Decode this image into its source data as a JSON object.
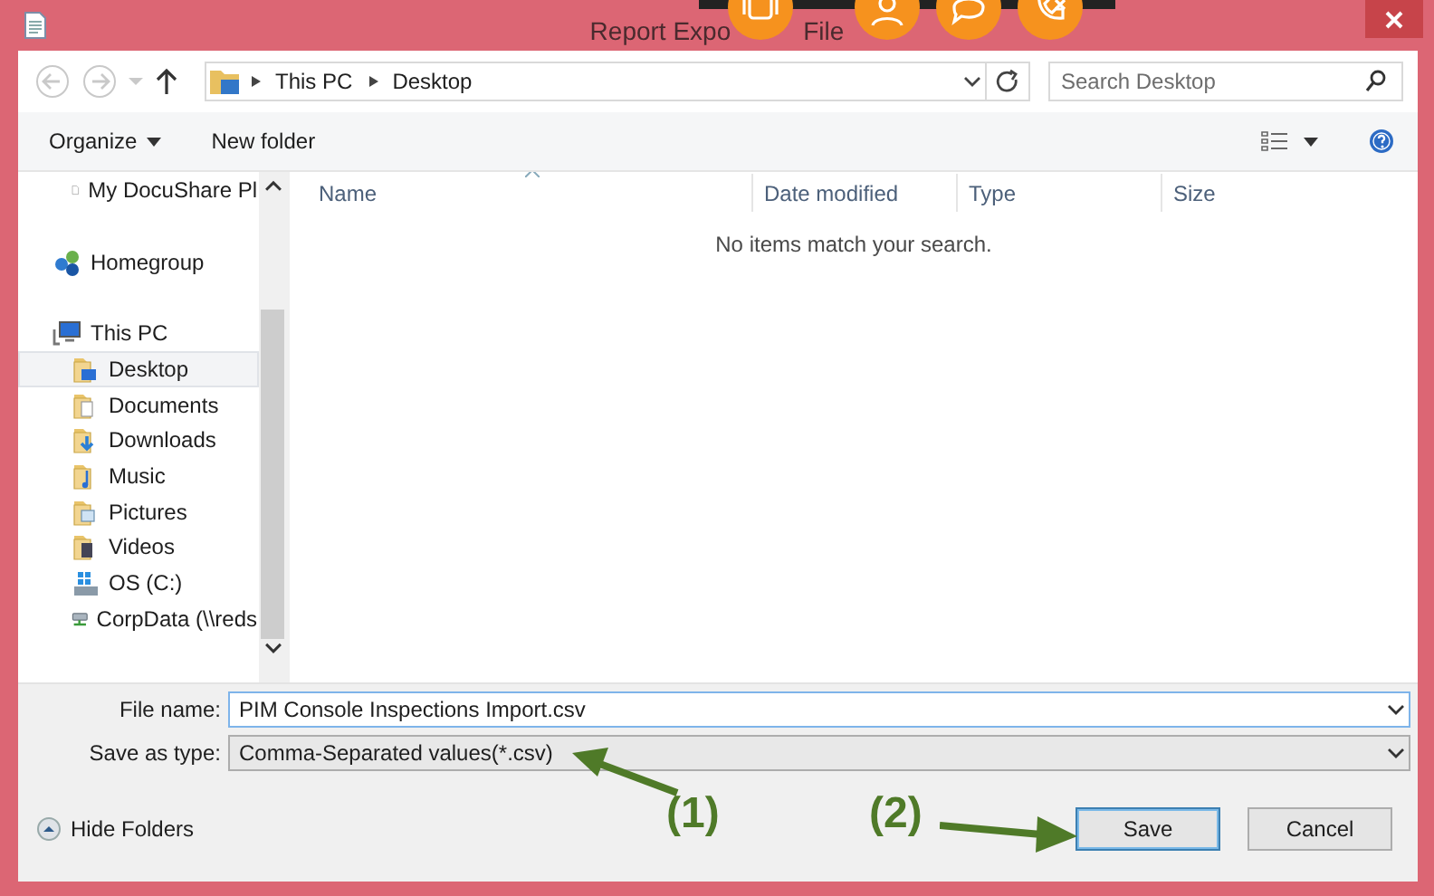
{
  "window": {
    "title_segments": [
      "Report Expo",
      "File"
    ]
  },
  "address_bar": {
    "path": [
      "This PC",
      "Desktop"
    ]
  },
  "search": {
    "placeholder": "Search Desktop"
  },
  "command_bar": {
    "organize": "Organize",
    "new_folder": "New folder"
  },
  "nav_pane": {
    "items": [
      {
        "children": [
          {
            "label": "My DocuShare Pl",
            "kind": "document",
            "selected": false
          }
        ]
      },
      {
        "label": "Homegroup",
        "kind": "homegroup",
        "selected": false
      },
      {
        "label": "This PC",
        "kind": "computer",
        "selected": false,
        "children": [
          {
            "label": "Desktop",
            "kind": "desktop",
            "selected": true
          },
          {
            "label": "Documents",
            "kind": "documents",
            "selected": false
          },
          {
            "label": "Downloads",
            "kind": "downloads",
            "selected": false
          },
          {
            "label": "Music",
            "kind": "music",
            "selected": false
          },
          {
            "label": "Pictures",
            "kind": "pictures",
            "selected": false
          },
          {
            "label": "Videos",
            "kind": "videos",
            "selected": false
          },
          {
            "label": "OS (C:)",
            "kind": "drive",
            "selected": false
          },
          {
            "label": "CorpData (\\\\reds",
            "kind": "network-drive",
            "selected": false
          }
        ]
      }
    ]
  },
  "file_list": {
    "columns": [
      "Name",
      "Date modified",
      "Type",
      "Size"
    ],
    "empty_message": "No items match your search."
  },
  "save_panel": {
    "file_name": {
      "label": "File name:",
      "value": "PIM Console Inspections Import.csv"
    },
    "save_as_type": {
      "label": "Save as type:",
      "value": "Comma-Separated values(*.csv)"
    },
    "hide_folders": "Hide Folders",
    "buttons": [
      {
        "label": "Save",
        "default": true
      },
      {
        "label": "Cancel",
        "default": false
      }
    ]
  },
  "annotations": [
    {
      "label": "(1)"
    },
    {
      "label": "(2)"
    }
  ]
}
